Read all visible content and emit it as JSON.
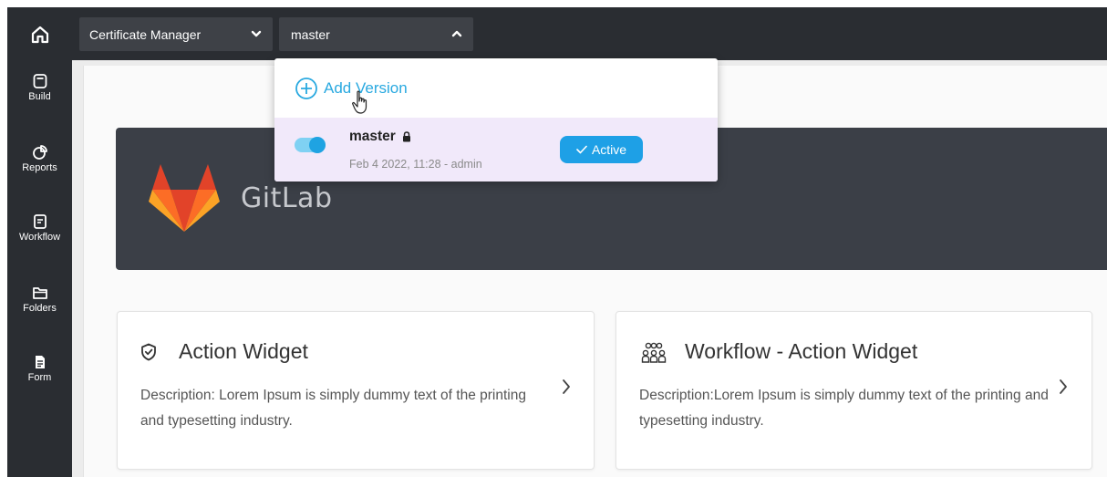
{
  "topbar": {
    "app_selector": "Certificate Manager",
    "version_selector": "master"
  },
  "sidebar": {
    "items": [
      {
        "label": "Build",
        "icon": "build-icon"
      },
      {
        "label": "Reports",
        "icon": "reports-icon"
      },
      {
        "label": "Workflow",
        "icon": "workflow-icon"
      },
      {
        "label": "Folders",
        "icon": "folder-icon"
      },
      {
        "label": "Form",
        "icon": "form-icon"
      }
    ]
  },
  "dropdown": {
    "add_version_label": "Add Version",
    "versions": [
      {
        "name": "master",
        "meta": "Feb 4 2022, 11:28 - admin",
        "badge": "Active",
        "toggle_on": true,
        "locked": true
      }
    ]
  },
  "banner": {
    "title": "GitLab"
  },
  "cards": [
    {
      "title": "Action Widget",
      "description": "Description: Lorem Ipsum is simply dummy text of the printing and typesetting industry.",
      "icon": "shield-check-icon"
    },
    {
      "title": "Workflow - Action Widget",
      "description": "Description:Lorem Ipsum is simply dummy text of the printing and typesetting industry.",
      "icon": "people-group-icon"
    }
  ],
  "colors": {
    "nav_background": "#2a2d32",
    "accent": "#1ea0e6",
    "banner_background": "#3b3f47",
    "selected_row": "#f1e9fa"
  }
}
